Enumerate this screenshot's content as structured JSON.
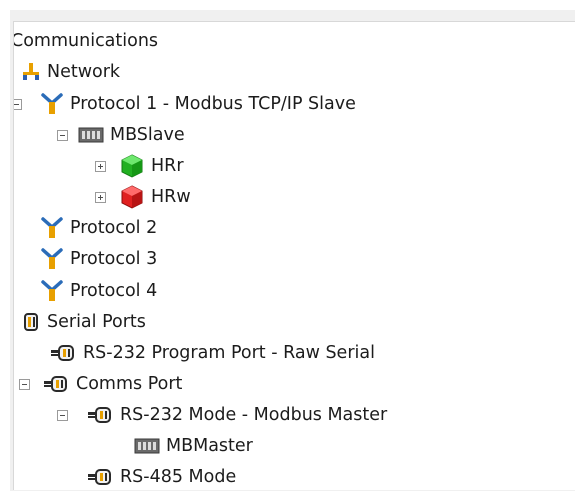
{
  "tree": {
    "communications": "Communications",
    "network": "Network",
    "protocol1": "Protocol 1 - Modbus TCP/IP Slave",
    "mbslave": "MBSlave",
    "hrr": "HRr",
    "hrw": "HRw",
    "protocol2": "Protocol 2",
    "protocol3": "Protocol 3",
    "protocol4": "Protocol 4",
    "serial_ports": "Serial Ports",
    "rs232_program_port": "RS-232 Program Port - Raw Serial",
    "comms_port": "Comms Port",
    "rs232_mode": "RS-232 Mode - Modbus Master",
    "mbmaster": "MBMaster",
    "rs485_mode": "RS-485 Mode"
  },
  "icons": {
    "network": "network-icon",
    "protocol": "protocol-fork-icon",
    "device": "device-block-icon",
    "register_read": "green-cube-icon",
    "register_write": "red-cube-icon",
    "serial_ports": "serial-ports-icon",
    "port": "plug-icon"
  },
  "colors": {
    "read": "#22b022",
    "write": "#e02020",
    "protocol": "#e8a000"
  }
}
